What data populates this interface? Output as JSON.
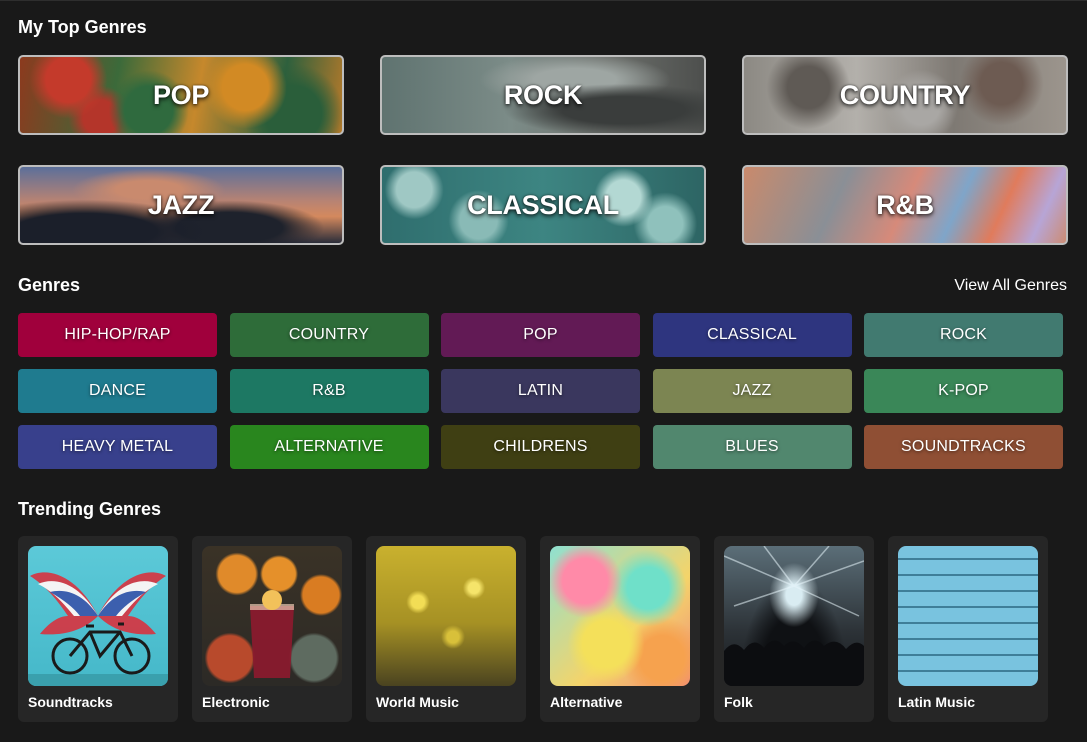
{
  "sections": {
    "top_title": "My Top Genres",
    "genres_title": "Genres",
    "view_all": "View All Genres",
    "trending_title": "Trending Genres"
  },
  "top_genres": [
    {
      "label": "POP",
      "image": "autumn-forest-aerial"
    },
    {
      "label": "ROCK",
      "image": "rocky-shore"
    },
    {
      "label": "COUNTRY",
      "image": "frosted-ground"
    },
    {
      "label": "JAZZ",
      "image": "sunset-clouds"
    },
    {
      "label": "CLASSICAL",
      "image": "teal-bokeh"
    },
    {
      "label": "R&B",
      "image": "iridescent-swirl"
    }
  ],
  "genres": [
    {
      "label": "HIP-HOP/RAP",
      "color": "#a0003c"
    },
    {
      "label": "COUNTRY",
      "color": "#2e6c39"
    },
    {
      "label": "POP",
      "color": "#621a55"
    },
    {
      "label": "CLASSICAL",
      "color": "#2e357f"
    },
    {
      "label": "ROCK",
      "color": "#417a70"
    },
    {
      "label": "DANCE",
      "color": "#1f7b8f"
    },
    {
      "label": "R&B",
      "color": "#1d7863"
    },
    {
      "label": "LATIN",
      "color": "#3a375e"
    },
    {
      "label": "JAZZ",
      "color": "#7c8552"
    },
    {
      "label": "K-POP",
      "color": "#3a8758"
    },
    {
      "label": "HEAVY METAL",
      "color": "#38408c"
    },
    {
      "label": "ALTERNATIVE",
      "color": "#29861e"
    },
    {
      "label": "CHILDRENS",
      "color": "#3f3f13"
    },
    {
      "label": "BLUES",
      "color": "#51876e"
    },
    {
      "label": "SOUNDTRACKS",
      "color": "#8f4f34"
    }
  ],
  "trending": [
    {
      "label": "Soundtracks",
      "image": "wings-bicycle-mural"
    },
    {
      "label": "Electronic",
      "image": "oranges-juice"
    },
    {
      "label": "World Music",
      "image": "golden-glitter"
    },
    {
      "label": "Alternative",
      "image": "colorful-liquid"
    },
    {
      "label": "Folk",
      "image": "concert-lights"
    },
    {
      "label": "Latin Music",
      "image": "blue-brick-wall"
    }
  ]
}
